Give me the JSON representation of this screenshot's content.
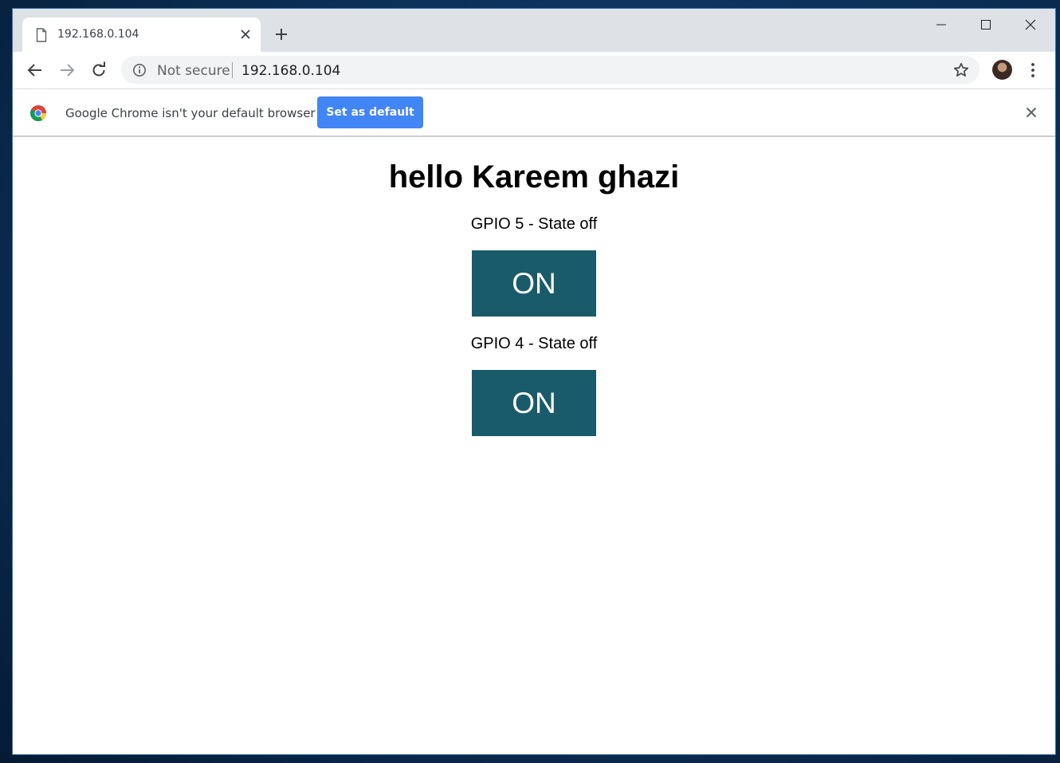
{
  "browser": {
    "tab_title": "192.168.0.104",
    "security_label": "Not secure",
    "url": "192.168.0.104"
  },
  "infobar": {
    "message": "Google Chrome isn't your default browser",
    "button_label": "Set as default"
  },
  "page": {
    "heading": "hello Kareem ghazi",
    "gpios": [
      {
        "label": "GPIO 5 - State off",
        "button_label": "ON"
      },
      {
        "label": "GPIO 4 - State off",
        "button_label": "ON"
      }
    ]
  },
  "colors": {
    "gpio_button": "#195b6a",
    "set_default_button": "#4285f4"
  },
  "icons": [
    "page-icon",
    "close-icon",
    "plus-icon",
    "minimize-icon",
    "maximize-icon",
    "back-icon",
    "forward-icon",
    "reload-icon",
    "info-icon",
    "star-icon",
    "avatar",
    "kebab-menu-icon",
    "chrome-logo-icon"
  ]
}
